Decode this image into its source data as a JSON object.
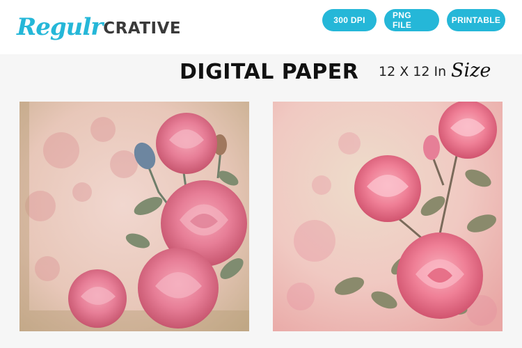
{
  "brand": {
    "script": "Regulr",
    "bold": "CRATIVE"
  },
  "badges": [
    "300 DPI",
    "PNG FILE",
    "PRINTABLE"
  ],
  "title": "DIGITAL PAPER",
  "size": {
    "dimensions": "12 X 12 In",
    "label": "Size"
  },
  "colors": {
    "accent": "#25b7d8",
    "rose": "#e66a8a",
    "leaf": "#7e8a6a",
    "paper": "#f2d2cc"
  },
  "papers": [
    {
      "motif": "vintage pink roses with buds on distressed parchment"
    },
    {
      "motif": "pink roses on branch with leaves on blush watercolor background"
    }
  ]
}
